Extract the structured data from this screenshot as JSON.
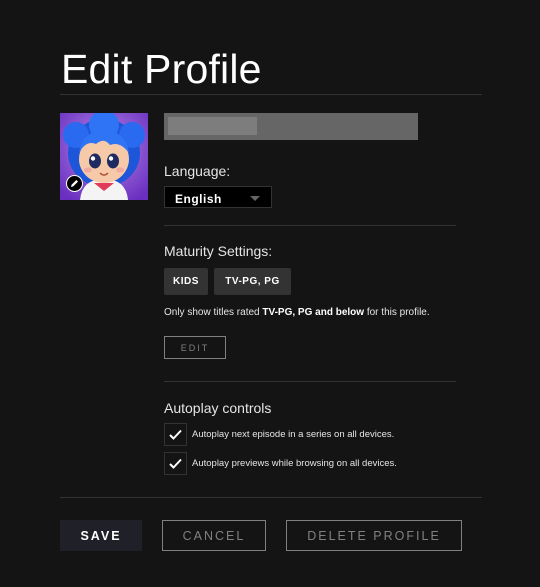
{
  "header": {
    "title": "Edit Profile"
  },
  "profile": {
    "name_value": ""
  },
  "language": {
    "label": "Language:",
    "selected": "English"
  },
  "maturity": {
    "label": "Maturity Settings:",
    "ratings": [
      "KIDS",
      "TV-PG, PG"
    ],
    "description_prefix": "Only show titles rated ",
    "description_rating": "TV-PG, PG and below",
    "description_suffix": " for this profile.",
    "edit_label": "EDIT"
  },
  "autoplay": {
    "label": "Autoplay controls",
    "options": [
      {
        "label": "Autoplay next episode in a series on all devices.",
        "checked": true
      },
      {
        "label": "Autoplay previews while browsing on all devices.",
        "checked": true
      }
    ]
  },
  "actions": {
    "save_label": "SAVE",
    "cancel_label": "CANCEL",
    "delete_label": "DELETE PROFILE"
  },
  "colors": {
    "background": "#141414",
    "divider": "#333333",
    "chip": "#333333",
    "input": "#666666",
    "muted_text": "#808080"
  }
}
